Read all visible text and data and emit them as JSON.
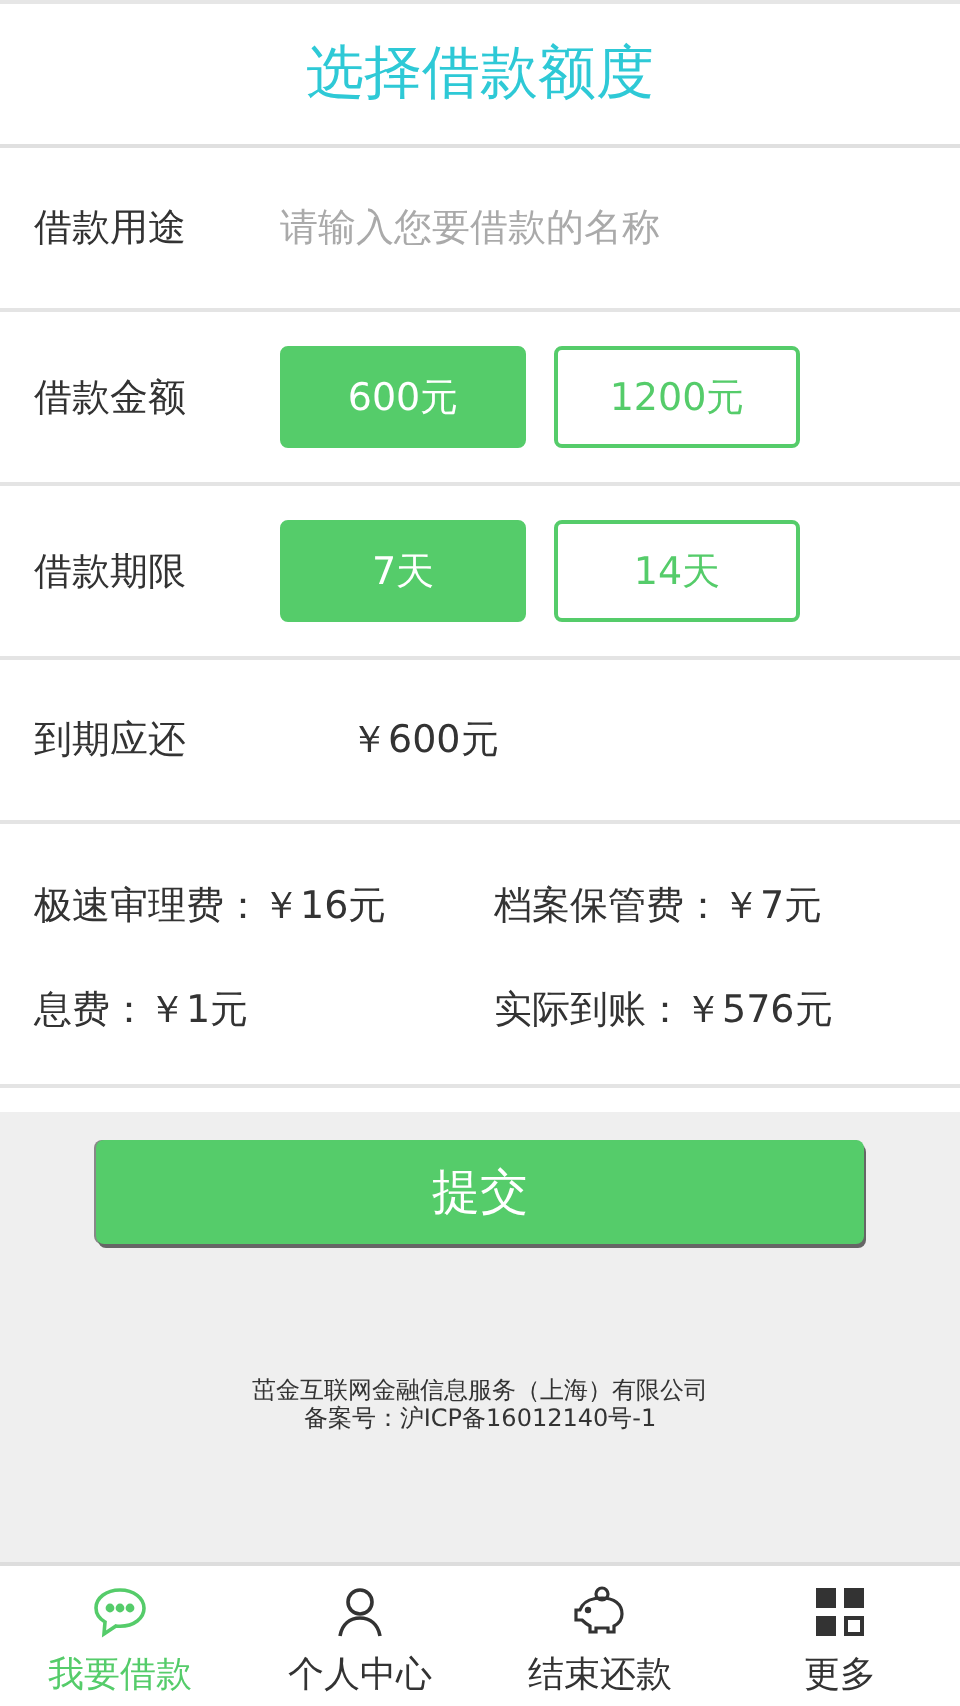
{
  "title": "选择借款额度",
  "purpose": {
    "label": "借款用途",
    "placeholder": "请输入您要借款的名称"
  },
  "amount": {
    "label": "借款金额",
    "options": [
      {
        "label": "600元",
        "selected": true
      },
      {
        "label": "1200元",
        "selected": false
      }
    ]
  },
  "term": {
    "label": "借款期限",
    "options": [
      {
        "label": "7天",
        "selected": true
      },
      {
        "label": "14天",
        "selected": false
      }
    ]
  },
  "due": {
    "label": "到期应还",
    "value": "￥600元"
  },
  "fees": [
    {
      "text": "极速审理费：￥16元"
    },
    {
      "text": "档案保管费：￥7元"
    },
    {
      "text": "息费：￥1元"
    },
    {
      "text": "实际到账：￥576元"
    }
  ],
  "submit": "提交",
  "footer": [
    "茁金互联网金融信息服务（上海）有限公司",
    "备案号：沪ICP备16012140号-1"
  ],
  "nav": [
    {
      "label": "我要借款",
      "selected": true
    },
    {
      "label": "个人中心",
      "selected": false
    },
    {
      "label": "结束还款",
      "selected": false
    },
    {
      "label": "更多",
      "selected": false
    }
  ]
}
